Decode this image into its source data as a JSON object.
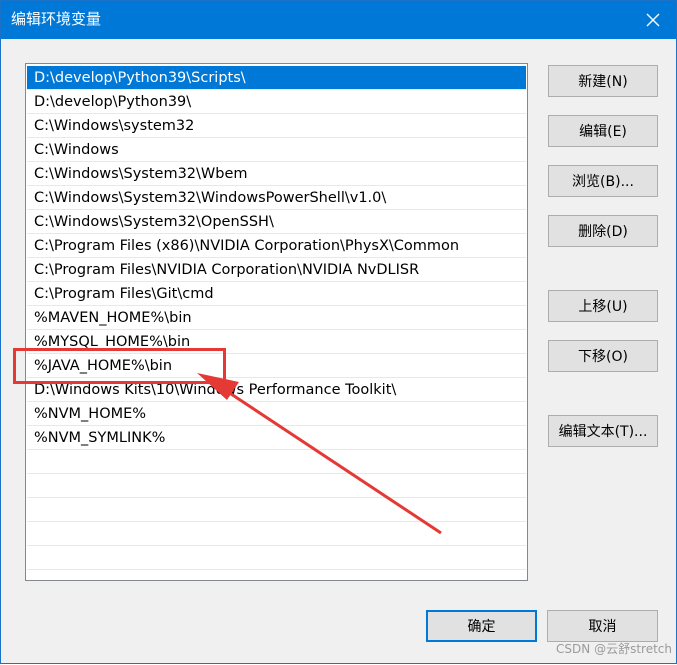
{
  "window": {
    "title": "编辑环境变量",
    "close_icon": "close-icon"
  },
  "list": {
    "items": [
      "D:\\develop\\Python39\\Scripts\\",
      "D:\\develop\\Python39\\",
      "C:\\Windows\\system32",
      "C:\\Windows",
      "C:\\Windows\\System32\\Wbem",
      "C:\\Windows\\System32\\WindowsPowerShell\\v1.0\\",
      "C:\\Windows\\System32\\OpenSSH\\",
      "C:\\Program Files (x86)\\NVIDIA Corporation\\PhysX\\Common",
      "C:\\Program Files\\NVIDIA Corporation\\NVIDIA NvDLISR",
      "C:\\Program Files\\Git\\cmd",
      "%MAVEN_HOME%\\bin",
      "%MYSQL_HOME%\\bin",
      "%JAVA_HOME%\\bin",
      "D:\\Windows Kits\\10\\Windows Performance Toolkit\\",
      "%NVM_HOME%",
      "%NVM_SYMLINK%",
      "",
      "",
      "",
      "",
      ""
    ],
    "selected_index": 0
  },
  "buttons": {
    "new": "新建(N)",
    "edit": "编辑(E)",
    "browse": "浏览(B)...",
    "delete": "删除(D)",
    "move_up": "上移(U)",
    "move_down": "下移(O)",
    "edit_text": "编辑文本(T)...",
    "ok": "确定",
    "cancel": "取消"
  },
  "annotation": {
    "highlight_color": "#e53935"
  },
  "watermark": "CSDN @云舒stretch",
  "colors": {
    "accent": "#0078d7",
    "annotation": "#e53935"
  }
}
